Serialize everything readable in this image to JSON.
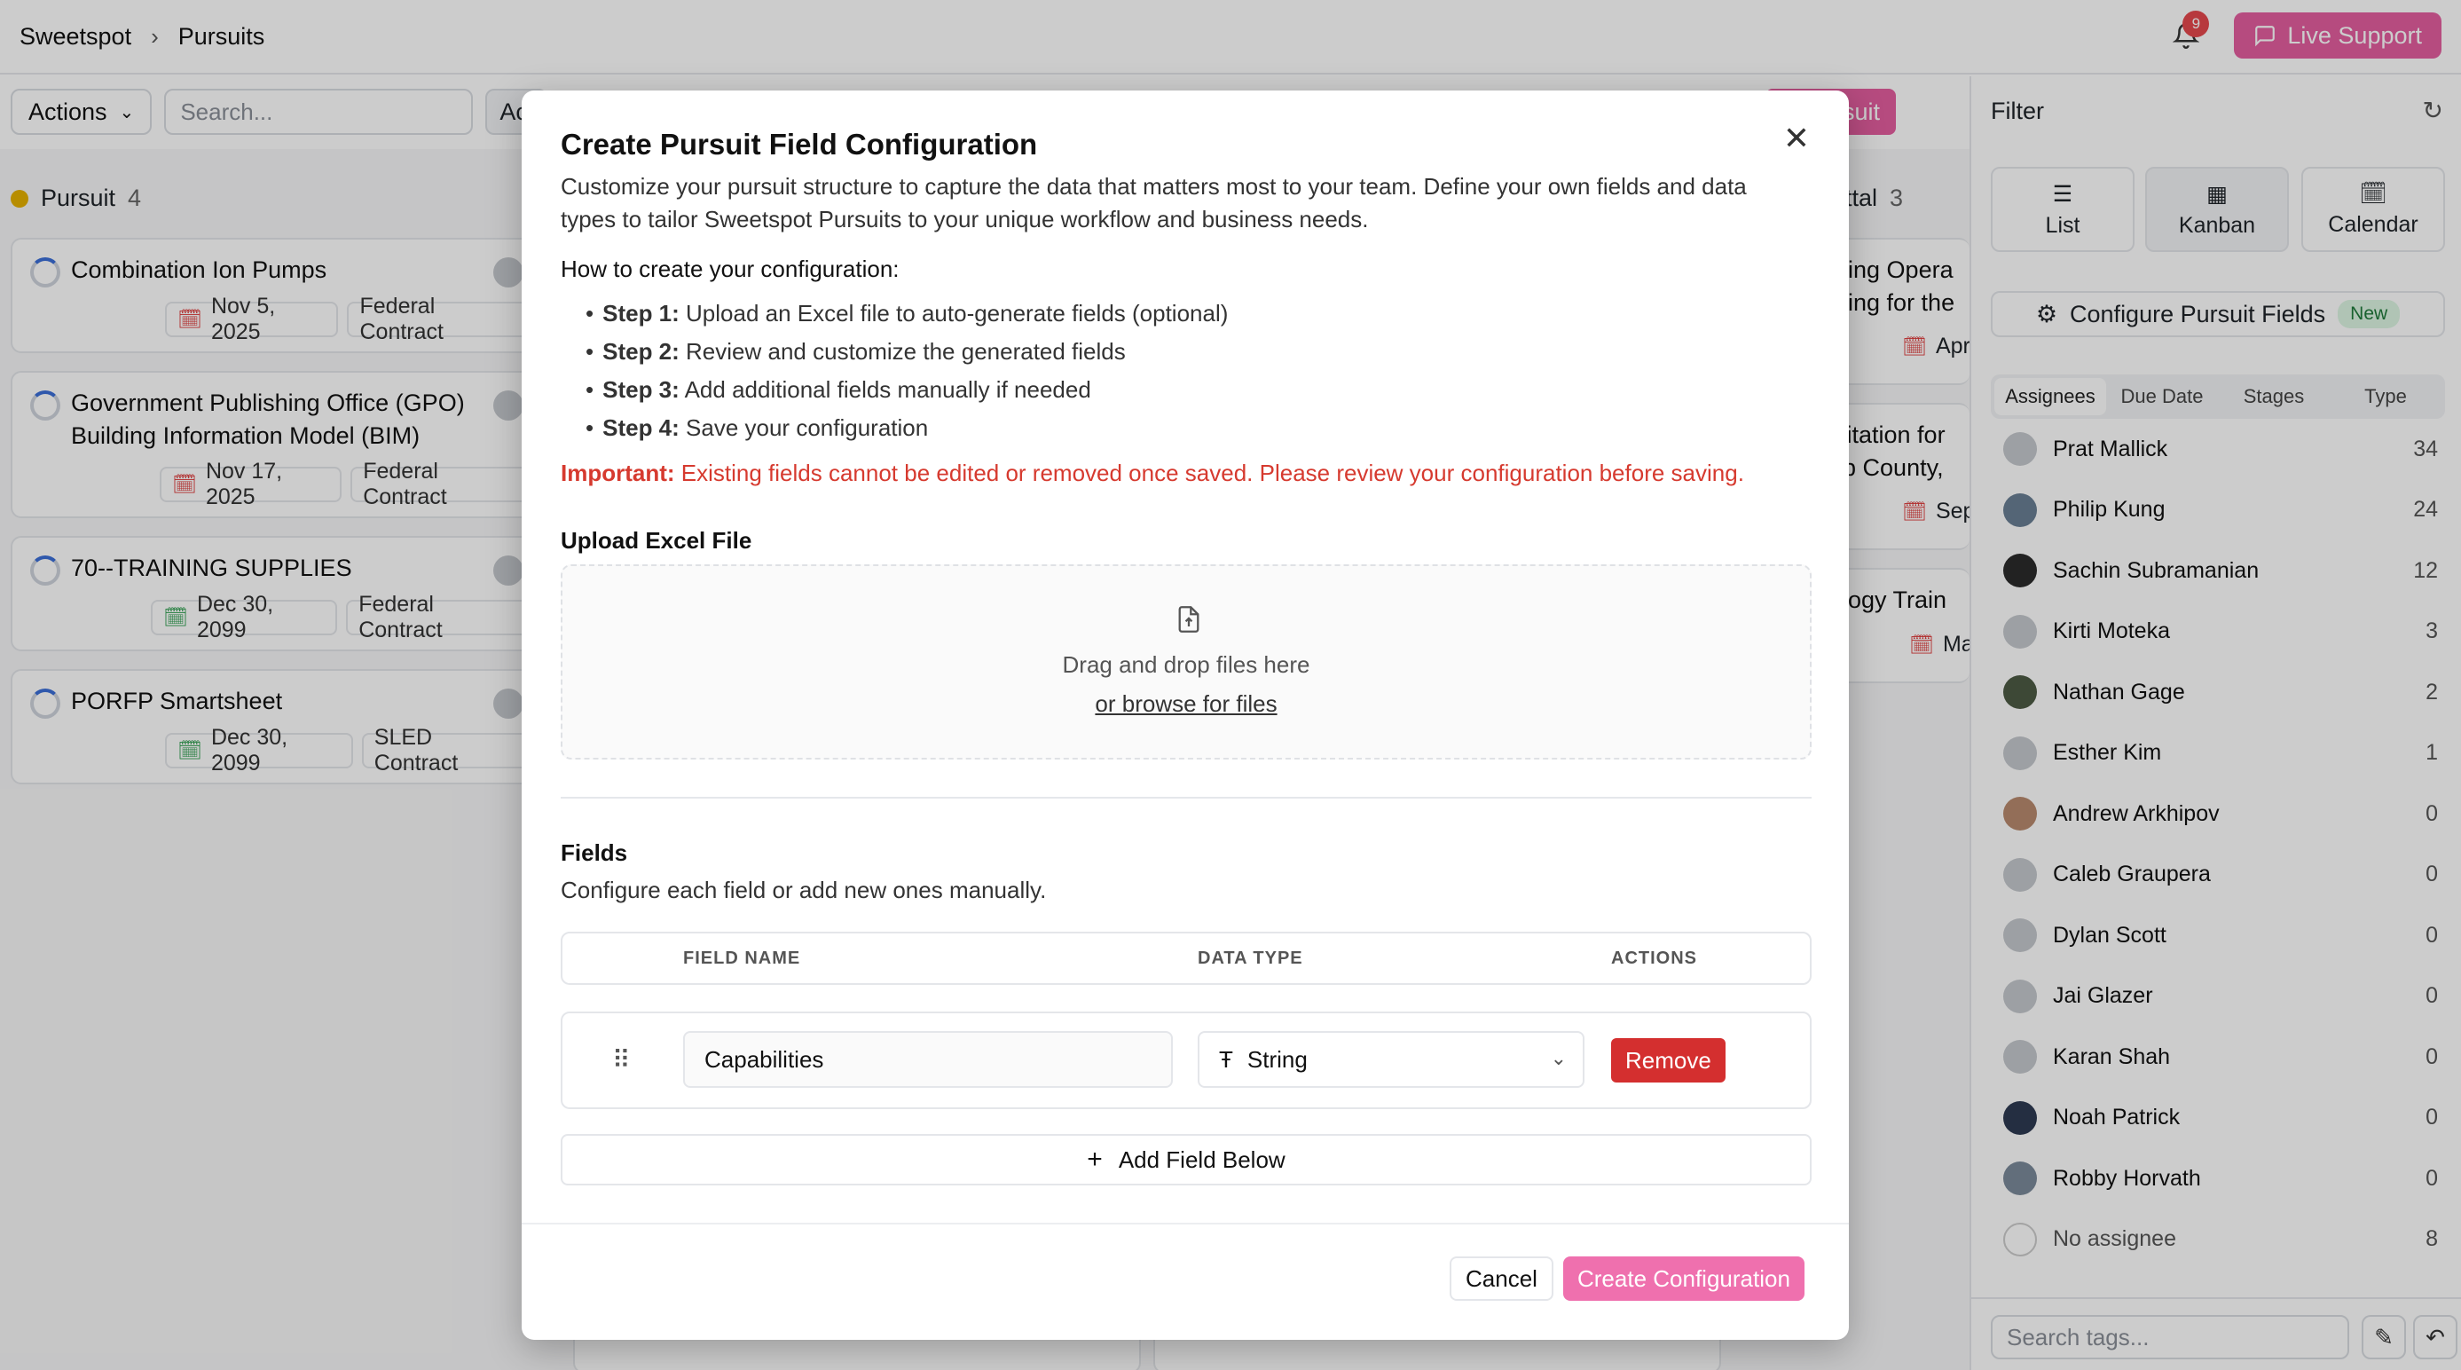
{
  "breadcrumb": {
    "root": "Sweetspot",
    "current": "Pursuits"
  },
  "notifications": {
    "count": "9"
  },
  "live_support": "Live Support",
  "toolbar": {
    "actions": "Actions",
    "search_placeholder": "Search...",
    "ac_partial": "Ac",
    "new_pursuit_partial": "w Pursuit"
  },
  "board": {
    "column1": {
      "name": "Pursuit",
      "count": "4"
    },
    "column3": {
      "partial_name": "ttal",
      "count": "3"
    },
    "cards": [
      {
        "title": "Combination Ion Pumps",
        "date": "Nov 5, 2025",
        "type": "Federal Contract"
      },
      {
        "title": "Government Publishing Office (GPO) Building Information Model (BIM)",
        "title_line1": "Government Publishing Office (GPO)",
        "title_line2": "Building Information Model (BIM)",
        "date": "Nov 17, 2025",
        "type": "Federal Contract"
      },
      {
        "title": "70--TRAINING SUPPLIES",
        "date": "Dec 30, 2099",
        "type": "Federal Contract"
      },
      {
        "title": "PORFP Smartsheet",
        "date": "Dec 30, 2099",
        "type": "SLED Contract"
      }
    ],
    "right_cards": [
      {
        "line1": "lding Opera",
        "line2": "ining for the",
        "date": "Apr"
      },
      {
        "line1": "icitation for",
        "line2": "bb County,",
        "date": "Sep"
      },
      {
        "line1": "ology Train",
        "date": "Ma"
      }
    ]
  },
  "filter": {
    "title": "Filter",
    "views": [
      {
        "label": "List",
        "icon": "list-icon"
      },
      {
        "label": "Kanban",
        "icon": "kanban-icon"
      },
      {
        "label": "Calendar",
        "icon": "calendar-icon"
      }
    ],
    "configure_label": "Configure Pursuit Fields",
    "configure_badge": "New",
    "tabs": [
      "Assignees",
      "Due Date",
      "Stages",
      "Type"
    ],
    "assignees": [
      {
        "name": "Prat Mallick",
        "count": "34"
      },
      {
        "name": "Philip Kung",
        "count": "24"
      },
      {
        "name": "Sachin Subramanian",
        "count": "12"
      },
      {
        "name": "Kirti Moteka",
        "count": "3"
      },
      {
        "name": "Nathan Gage",
        "count": "2"
      },
      {
        "name": "Esther Kim",
        "count": "1"
      },
      {
        "name": "Andrew Arkhipov",
        "count": "0"
      },
      {
        "name": "Caleb Graupera",
        "count": "0"
      },
      {
        "name": "Dylan Scott",
        "count": "0"
      },
      {
        "name": "Jai Glazer",
        "count": "0"
      },
      {
        "name": "Karan Shah",
        "count": "0"
      },
      {
        "name": "Noah Patrick",
        "count": "0"
      },
      {
        "name": "Robby Horvath",
        "count": "0"
      },
      {
        "name": "No assignee",
        "count": "8"
      }
    ],
    "tag_search_placeholder": "Search tags..."
  },
  "modal": {
    "title": "Create Pursuit Field Configuration",
    "description": "Customize your pursuit structure to capture the data that matters most to your team. Define your own fields and data types to tailor Sweetspot Pursuits to your unique workflow and business needs.",
    "how_title": "How to create your configuration:",
    "steps": [
      {
        "label": "Step 1:",
        "text": "Upload an Excel file to auto-generate fields (optional)"
      },
      {
        "label": "Step 2:",
        "text": "Review and customize the generated fields"
      },
      {
        "label": "Step 3:",
        "text": "Add additional fields manually if needed"
      },
      {
        "label": "Step 4:",
        "text": "Save your configuration"
      }
    ],
    "important_label": "Important:",
    "important_text": "Existing fields cannot be edited or removed once saved. Please review your configuration before saving.",
    "upload_label": "Upload Excel File",
    "dropzone_text": "Drag and drop files here",
    "dropzone_link": "or browse for files",
    "fields_title": "Fields",
    "fields_subtitle": "Configure each field or add new ones manually.",
    "columns": [
      "FIELD NAME",
      "DATA TYPE",
      "ACTIONS"
    ],
    "rows": [
      {
        "field_name": "Capabilities",
        "data_type": "String",
        "action": "Remove"
      }
    ],
    "add_field": "Add Field Below",
    "cancel": "Cancel",
    "create": "Create Configuration"
  }
}
